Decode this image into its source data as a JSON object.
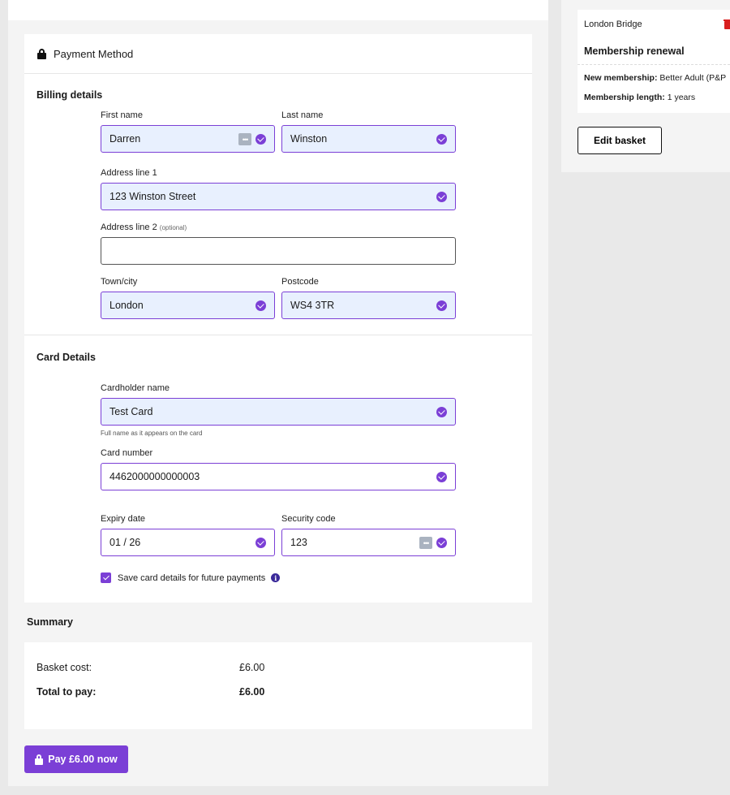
{
  "payment": {
    "title": "Payment Method",
    "billing": {
      "title": "Billing details",
      "first_name": {
        "label": "First name",
        "value": "Darren"
      },
      "last_name": {
        "label": "Last name",
        "value": "Winston"
      },
      "address1": {
        "label": "Address line 1",
        "value": "123 Winston Street"
      },
      "address2": {
        "label": "Address line 2",
        "optional": "(optional)",
        "value": ""
      },
      "town": {
        "label": "Town/city",
        "value": "London"
      },
      "postcode": {
        "label": "Postcode",
        "value": "WS4 3TR"
      }
    },
    "card": {
      "title": "Card Details",
      "holder": {
        "label": "Cardholder name",
        "value": "Test Card",
        "hint": "Full name as it appears on the card"
      },
      "number": {
        "label": "Card number",
        "value": "4462000000000003"
      },
      "expiry": {
        "label": "Expiry date",
        "value": "01 / 26"
      },
      "security": {
        "label": "Security code",
        "value": "123"
      },
      "save_label": "Save card details for future payments",
      "save_checked": true
    }
  },
  "summary": {
    "title": "Summary",
    "basket_cost_label": "Basket cost:",
    "basket_cost_value": "£6.00",
    "total_label": "Total to pay:",
    "total_value": "£6.00"
  },
  "pay_button": "Pay £6.00 now",
  "basket": {
    "location": "London Bridge",
    "title": "Membership renewal",
    "membership_label": "New membership:",
    "membership_value": "Better Adult (P&P",
    "length_label": "Membership length:",
    "length_value": "1 years",
    "edit_button": "Edit basket"
  },
  "colors": {
    "accent": "#7b3fd6",
    "autofill": "#e8f0fe",
    "danger": "#d91f1f"
  }
}
